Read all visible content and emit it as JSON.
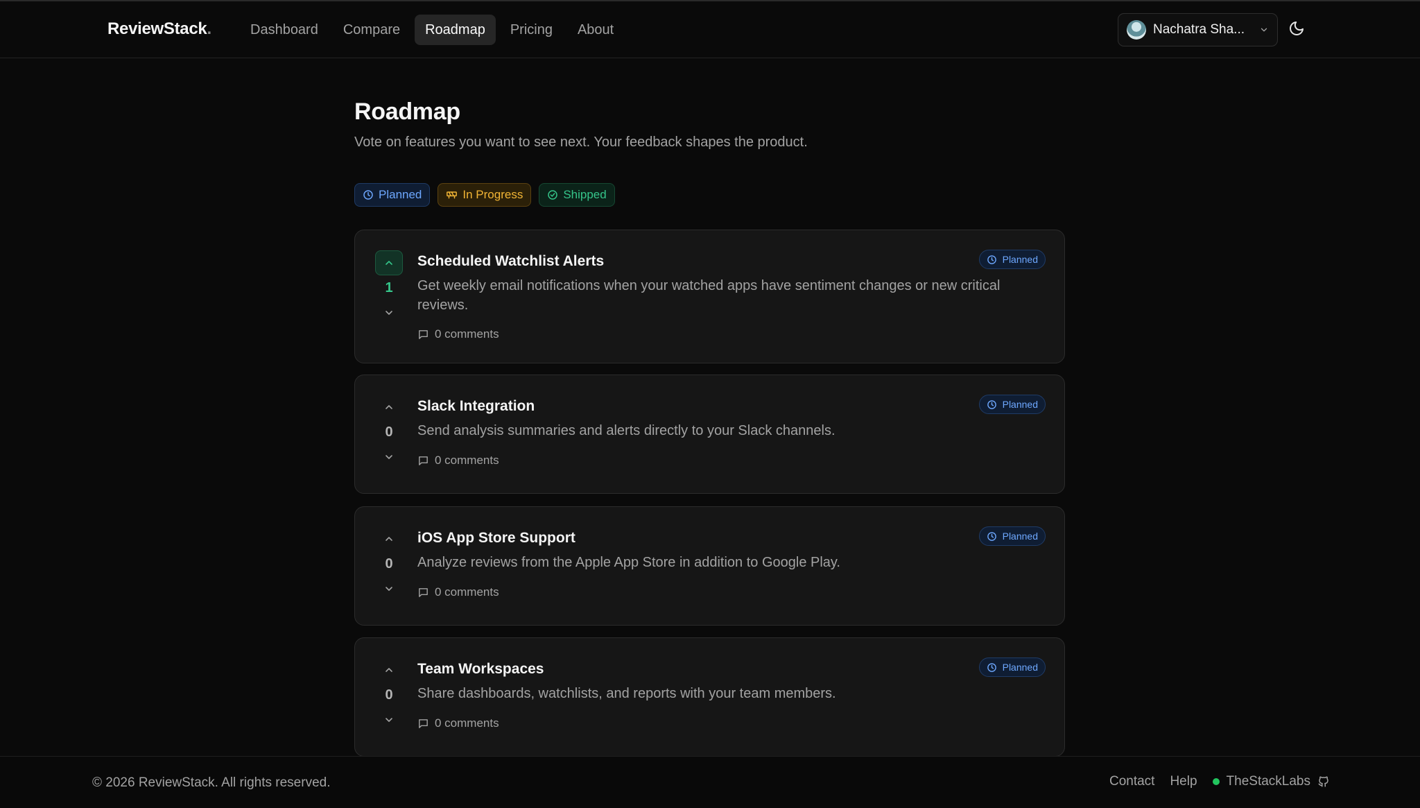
{
  "brand": {
    "name": "ReviewStack",
    "dot": "."
  },
  "nav": {
    "items": [
      {
        "label": "Dashboard"
      },
      {
        "label": "Compare"
      },
      {
        "label": "Roadmap",
        "active": true
      },
      {
        "label": "Pricing"
      },
      {
        "label": "About"
      }
    ]
  },
  "user": {
    "name": "Nachatra Sha..."
  },
  "page": {
    "title": "Roadmap",
    "subtitle": "Vote on features you want to see next. Your feedback shapes the product."
  },
  "filters": [
    {
      "label": "Planned",
      "icon": "clock-icon",
      "color": "#6ea8ff"
    },
    {
      "label": "In Progress",
      "icon": "construction-icon",
      "color": "#f2b535"
    },
    {
      "label": "Shipped",
      "icon": "check-circle-icon",
      "color": "#35c58a"
    }
  ],
  "features": [
    {
      "title": "Scheduled Watchlist Alerts",
      "description": "Get weekly email notifications when your watched apps have sentiment changes or new critical reviews.",
      "votes": "1",
      "voted": true,
      "comments": "0 comments",
      "status": "Planned"
    },
    {
      "title": "Slack Integration",
      "description": "Send analysis summaries and alerts directly to your Slack channels.",
      "votes": "0",
      "voted": false,
      "comments": "0 comments",
      "status": "Planned"
    },
    {
      "title": "iOS App Store Support",
      "description": "Analyze reviews from the Apple App Store in addition to Google Play.",
      "votes": "0",
      "voted": false,
      "comments": "0 comments",
      "status": "Planned"
    },
    {
      "title": "Team Workspaces",
      "description": "Share dashboards, watchlists, and reports with your team members.",
      "votes": "0",
      "voted": false,
      "comments": "0 comments",
      "status": "Planned"
    }
  ],
  "footer": {
    "copyright": "© 2026 ReviewStack. All rights reserved.",
    "contact": "Contact",
    "help": "Help",
    "org": "TheStackLabs"
  },
  "colors": {
    "accent_green": "#35c58a",
    "planned_blue": "#6ea8ff",
    "progress_amber": "#f2b535",
    "background": "#0a0a0a",
    "card": "#161616"
  }
}
